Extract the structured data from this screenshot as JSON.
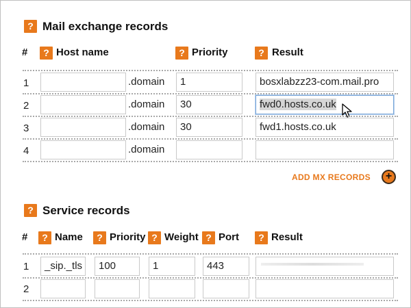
{
  "mx": {
    "title": "Mail exchange records",
    "help_glyph": "?",
    "col_hash": "#",
    "col_host": "Host name",
    "col_priority": "Priority",
    "col_result": "Result",
    "domain_suffix": ".domain",
    "rows": [
      {
        "num": "1",
        "host": "",
        "priority": "1",
        "result": "bosxlabzz23-com.mail.pro"
      },
      {
        "num": "2",
        "host": "",
        "priority": "30",
        "result": "fwd0.hosts.co.uk"
      },
      {
        "num": "3",
        "host": "",
        "priority": "30",
        "result": "fwd1.hosts.co.uk"
      },
      {
        "num": "4",
        "host": "",
        "priority": "",
        "result": ""
      }
    ],
    "add_label": "ADD MX RECORDS",
    "add_glyph": "+"
  },
  "srv": {
    "title": "Service records",
    "col_hash": "#",
    "col_name": "Name",
    "col_priority": "Priority",
    "col_weight": "Weight",
    "col_port": "Port",
    "col_result": "Result",
    "rows": [
      {
        "num": "1",
        "name": "_sip._tls",
        "priority": "100",
        "weight": "1",
        "port": "443",
        "result": ""
      },
      {
        "num": "2",
        "name": "",
        "priority": "",
        "weight": "",
        "port": "",
        "result": ""
      }
    ]
  },
  "colors": {
    "accent": "#e8791c",
    "focus": "#7aa7d8"
  },
  "icons": {
    "help": "help-icon",
    "add": "add-circle-icon",
    "cursor": "mouse-pointer-icon"
  }
}
